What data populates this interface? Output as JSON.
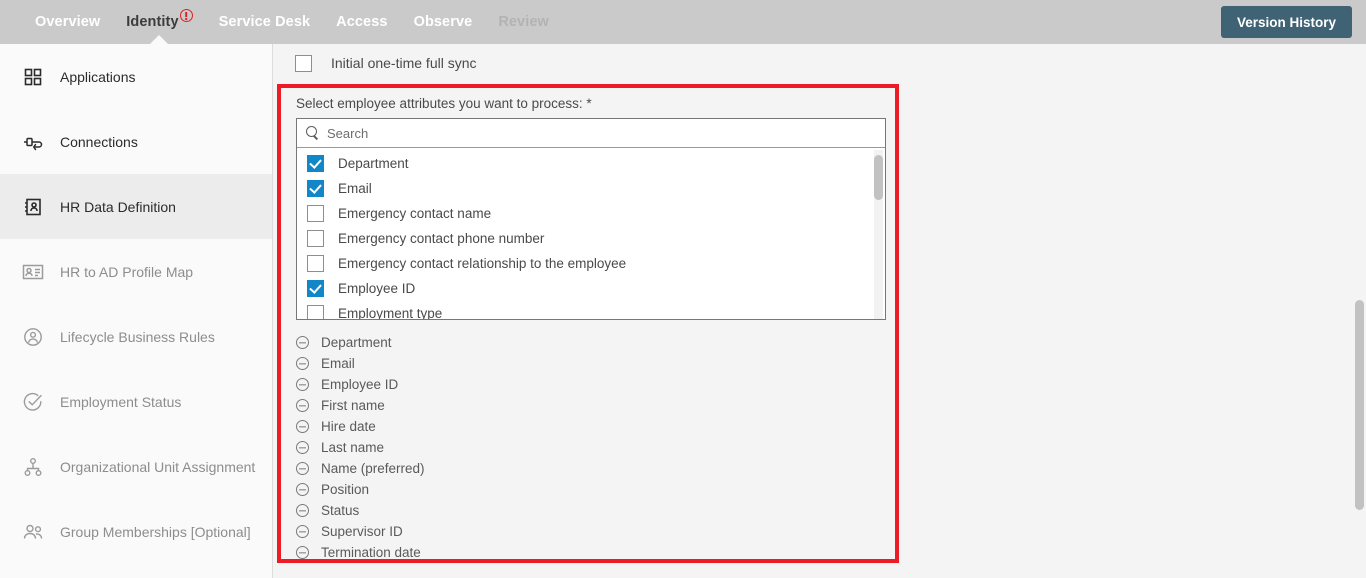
{
  "header": {
    "tabs": [
      {
        "label": "Overview",
        "state": "normal",
        "warning": false
      },
      {
        "label": "Identity",
        "state": "active",
        "warning": true
      },
      {
        "label": "Service Desk",
        "state": "normal",
        "warning": false
      },
      {
        "label": "Access",
        "state": "normal",
        "warning": false
      },
      {
        "label": "Observe",
        "state": "normal",
        "warning": false
      },
      {
        "label": "Review",
        "state": "disabled",
        "warning": false
      }
    ],
    "version_history_label": "Version History",
    "background_color": "#cacaca",
    "version_button_color": "#3f6275",
    "warning_color": "#e02020"
  },
  "sidebar": {
    "items": [
      {
        "label": "Applications",
        "icon": "grid-icon",
        "selected": false,
        "dim": false
      },
      {
        "label": "Connections",
        "icon": "connector-icon",
        "selected": false,
        "dim": false
      },
      {
        "label": "HR Data Definition",
        "icon": "address-book-icon",
        "selected": true,
        "dim": false
      },
      {
        "label": "HR to AD Profile Map",
        "icon": "id-card-icon",
        "selected": false,
        "dim": true
      },
      {
        "label": "Lifecycle Business Rules",
        "icon": "user-circle-icon",
        "selected": false,
        "dim": true
      },
      {
        "label": "Employment Status",
        "icon": "check-circle-icon",
        "selected": false,
        "dim": true
      },
      {
        "label": "Organizational Unit Assignment",
        "icon": "org-chart-icon",
        "selected": false,
        "dim": true
      },
      {
        "label": "Group Memberships [Optional]",
        "icon": "users-icon",
        "selected": false,
        "dim": true
      }
    ],
    "selected_background": "#ececec"
  },
  "main": {
    "initial_sync": {
      "label": "Initial one-time full sync",
      "checked": false
    },
    "attribute_prompt": "Select employee attributes you want to process: *",
    "search": {
      "placeholder": "Search",
      "value": "",
      "icon": "search-icon"
    },
    "options": [
      {
        "label": "Department",
        "checked": true
      },
      {
        "label": "Email",
        "checked": true
      },
      {
        "label": "Emergency contact name",
        "checked": false
      },
      {
        "label": "Emergency contact phone number",
        "checked": false
      },
      {
        "label": "Emergency contact relationship to the employee",
        "checked": false
      },
      {
        "label": "Employee ID",
        "checked": true
      },
      {
        "label": "Employment type",
        "checked": false
      }
    ],
    "selected_attributes": [
      "Department",
      "Email",
      "Employee ID",
      "First name",
      "Hire date",
      "Last name",
      "Name (preferred)",
      "Position",
      "Status",
      "Supervisor ID",
      "Termination date"
    ],
    "highlight_border_color": "#ed1c24",
    "checkbox_color": "#1287c8"
  }
}
